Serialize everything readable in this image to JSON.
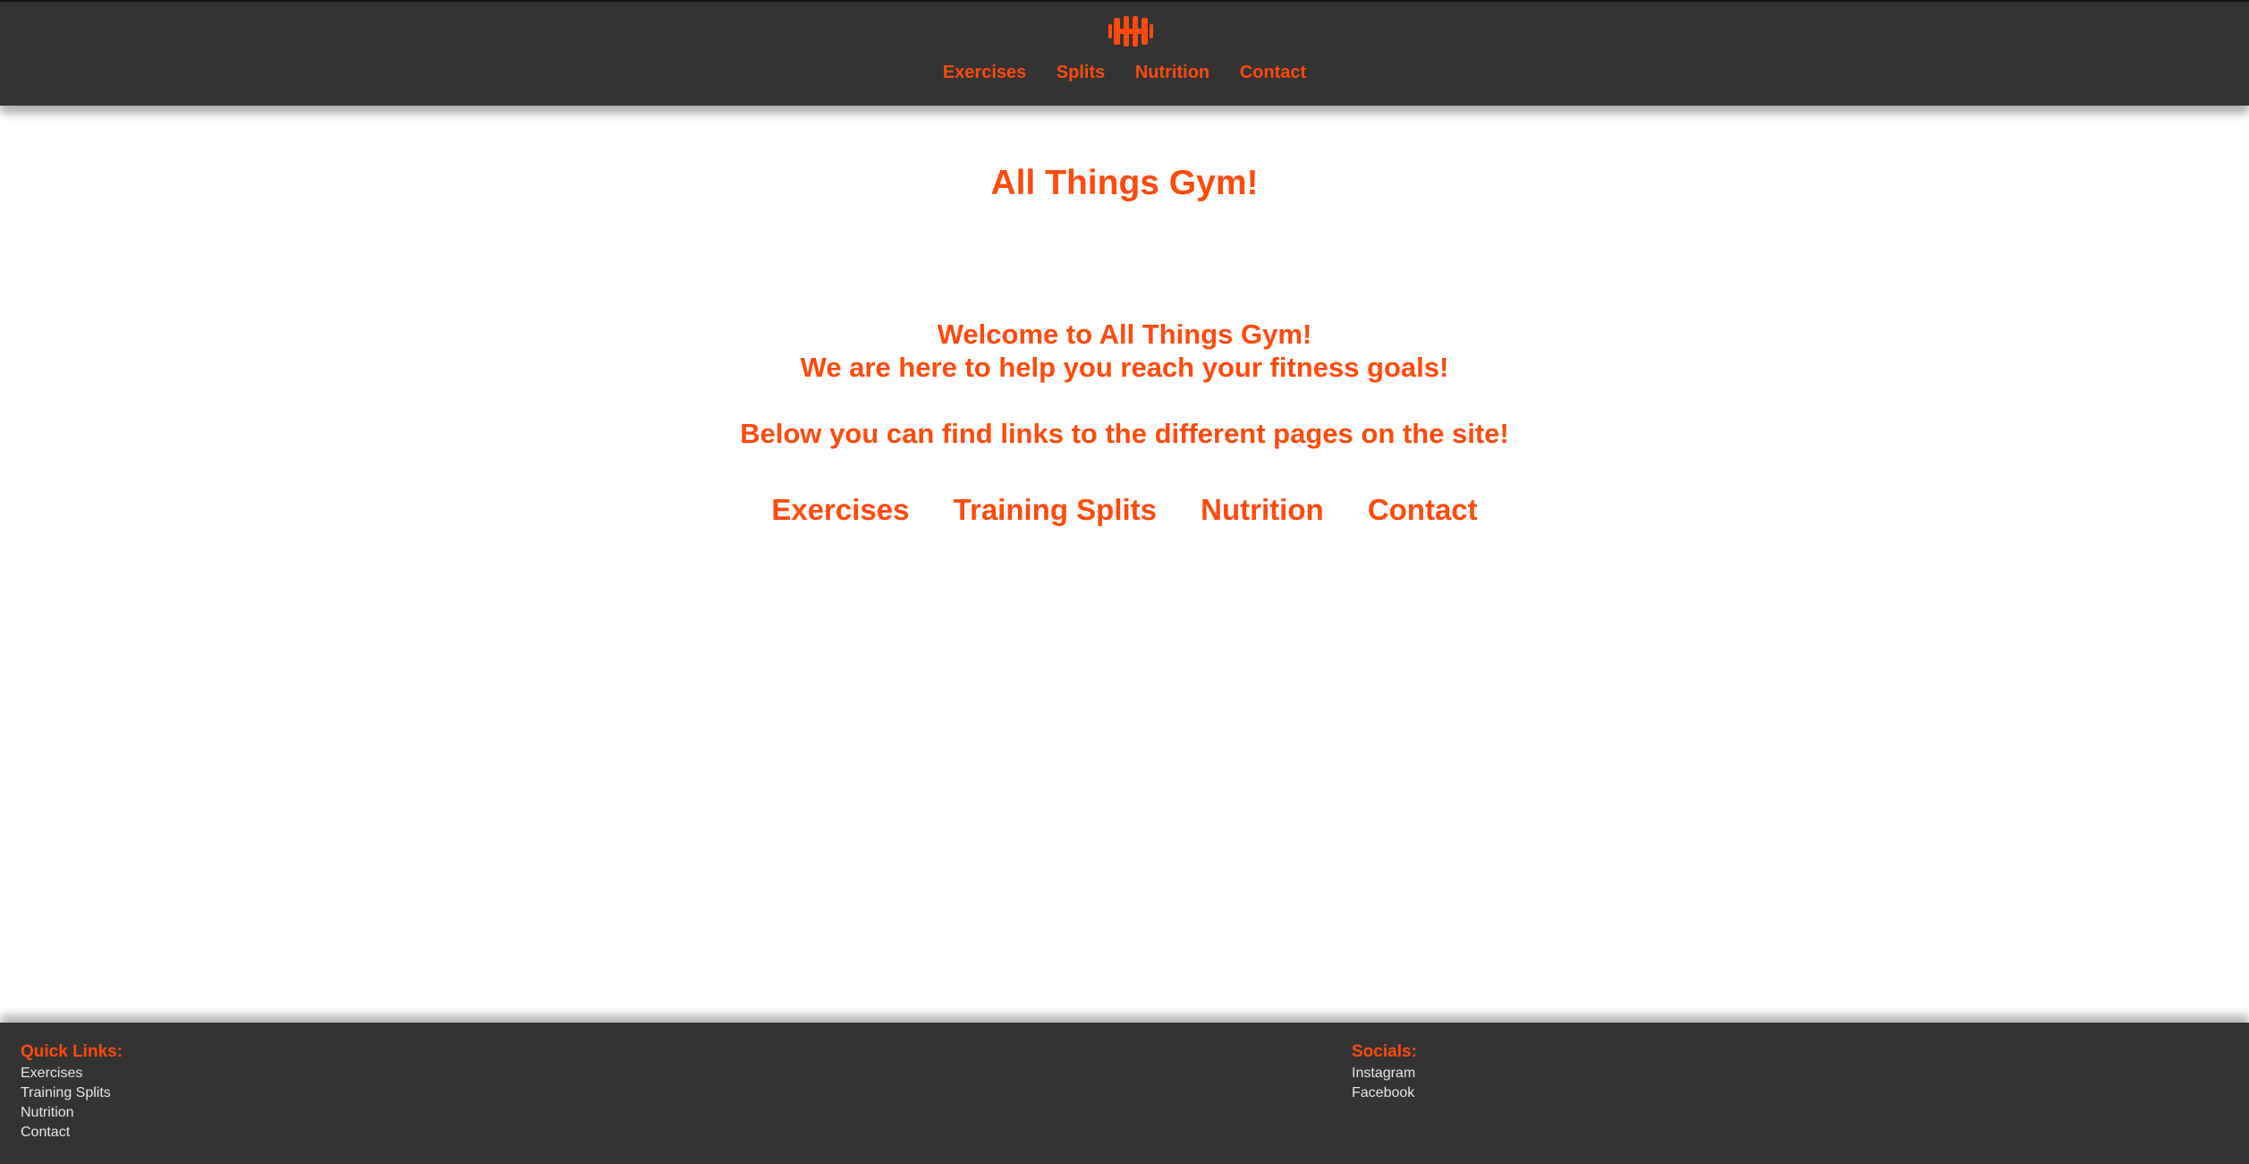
{
  "colors": {
    "accent": "#ff4a0d",
    "bar_background": "#333333",
    "page_background": "#ffffff",
    "footer_link": "#e6e6e6"
  },
  "header": {
    "logo_icon": "dumbbell-icon",
    "nav": [
      "Exercises",
      "Splits",
      "Nutrition",
      "Contact"
    ]
  },
  "main": {
    "title": "All Things Gym!",
    "welcome_line_1": "Welcome to All Things Gym!",
    "welcome_line_2": "We are here to help you reach your fitness goals!",
    "welcome_line_3": "Below you can find links to the different pages on the site!",
    "links": [
      "Exercises",
      "Training Splits",
      "Nutrition",
      "Contact"
    ]
  },
  "footer": {
    "quick_links_heading": "Quick Links:",
    "quick_links": [
      "Exercises",
      "Training Splits",
      "Nutrition",
      "Contact"
    ],
    "socials_heading": "Socials:",
    "socials": [
      "Instagram",
      "Facebook"
    ]
  }
}
